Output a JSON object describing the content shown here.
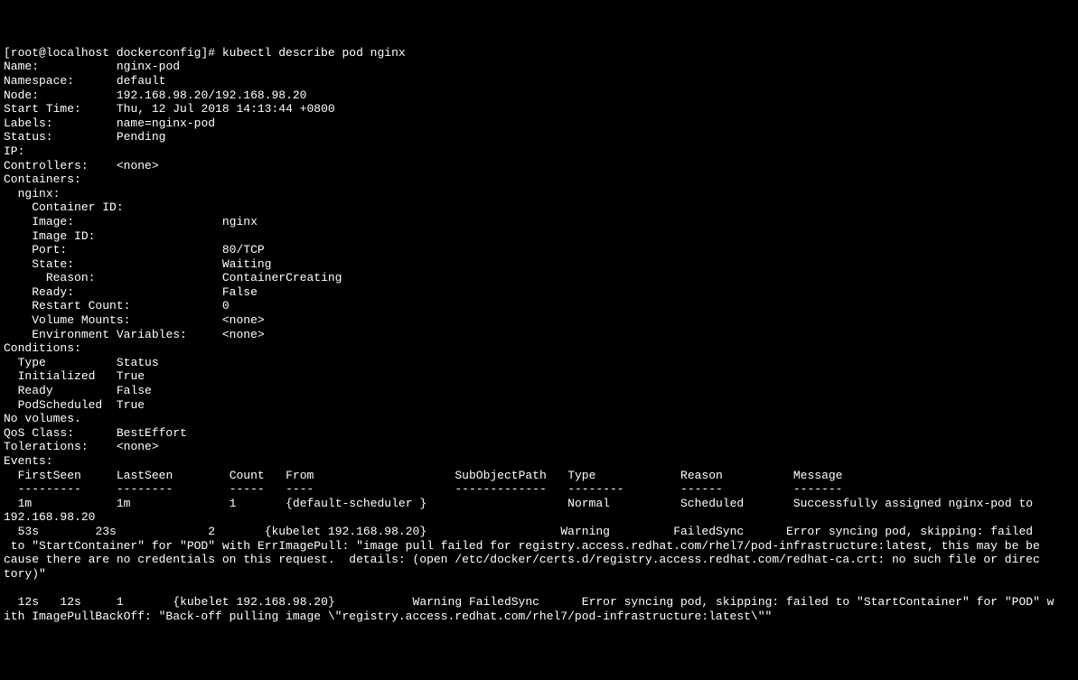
{
  "prompt": "[root@localhost dockerconfig]# ",
  "command": "kubectl describe pod nginx",
  "pod": {
    "name_label": "Name:",
    "name_value": "nginx-pod",
    "namespace_label": "Namespace:",
    "namespace_value": "default",
    "node_label": "Node:",
    "node_value": "192.168.98.20/192.168.98.20",
    "start_time_label": "Start Time:",
    "start_time_value": "Thu, 12 Jul 2018 14:13:44 +0800",
    "labels_label": "Labels:",
    "labels_value": "name=nginx-pod",
    "status_label": "Status:",
    "status_value": "Pending",
    "ip_label": "IP:",
    "ip_value": "",
    "controllers_label": "Controllers:",
    "controllers_value": "<none>"
  },
  "containers_header": "Containers:",
  "container": {
    "name": "nginx:",
    "container_id_label": "Container ID:",
    "container_id_value": "",
    "image_label": "Image:",
    "image_value": "nginx",
    "image_id_label": "Image ID:",
    "image_id_value": "",
    "port_label": "Port:",
    "port_value": "80/TCP",
    "state_label": "State:",
    "state_value": "Waiting",
    "reason_label": "Reason:",
    "reason_value": "ContainerCreating",
    "ready_label": "Ready:",
    "ready_value": "False",
    "restart_count_label": "Restart Count:",
    "restart_count_value": "0",
    "volume_mounts_label": "Volume Mounts:",
    "volume_mounts_value": "<none>",
    "env_vars_label": "Environment Variables:",
    "env_vars_value": "<none>"
  },
  "conditions_header": "Conditions:",
  "conditions": {
    "type_header": "Type",
    "status_header": "Status",
    "rows": [
      {
        "type": "Initialized",
        "status": "True"
      },
      {
        "type": "Ready",
        "status": "False"
      },
      {
        "type": "PodScheduled",
        "status": "True"
      }
    ]
  },
  "no_volumes": "No volumes.",
  "qos_label": "QoS Class:",
  "qos_value": "BestEffort",
  "tolerations_label": "Tolerations:",
  "tolerations_value": "<none>",
  "events_header": "Events:",
  "events_table": {
    "headers": {
      "firstseen": "FirstSeen",
      "lastseen": "LastSeen",
      "count": "Count",
      "from": "From",
      "subobjectpath": "SubObjectPath",
      "type": "Type",
      "reason": "Reason",
      "message": "Message"
    },
    "dashes": {
      "d1": "---------",
      "d2": "--------",
      "d3": "-----",
      "d4": "----",
      "d5": "-------------",
      "d6": "--------",
      "d7": "------",
      "d8": "-------"
    }
  },
  "event1": {
    "firstseen": "1m",
    "lastseen": "1m",
    "count": "1",
    "from": "{default-scheduler }",
    "type": "Normal",
    "reason": "Scheduled",
    "message_part1": "Successfully assigned nginx-pod to",
    "message_line2": "192.168.98.20"
  },
  "event2": {
    "firstseen": "53s",
    "lastseen": "23s",
    "count": "2",
    "from": "{kubelet 192.168.98.20}",
    "type": "Warning",
    "reason": "FailedSync",
    "message_part1": "Error syncing pod, skipping: failed",
    "wrap_line1": " to \"StartContainer\" for \"POD\" with ErrImagePull: \"image pull failed for registry.access.redhat.com/rhel7/pod-infrastructure:latest, this may be be",
    "wrap_line2": "cause there are no credentials on this request.  details: (open /etc/docker/certs.d/registry.access.redhat.com/redhat-ca.crt: no such file or direc",
    "wrap_line3": "tory)\""
  },
  "event3": {
    "firstseen": "12s",
    "lastseen": "12s",
    "count": "1",
    "from": "{kubelet 192.168.98.20}",
    "type": "Warning",
    "reason": "FailedSync",
    "message_part1": "Error syncing pod, skipping: failed to \"StartContainer\" for \"POD\" w",
    "wrap_line1": "ith ImagePullBackOff: \"Back-off pulling image \\\"registry.access.redhat.com/rhel7/pod-infrastructure:latest\\\"\""
  }
}
